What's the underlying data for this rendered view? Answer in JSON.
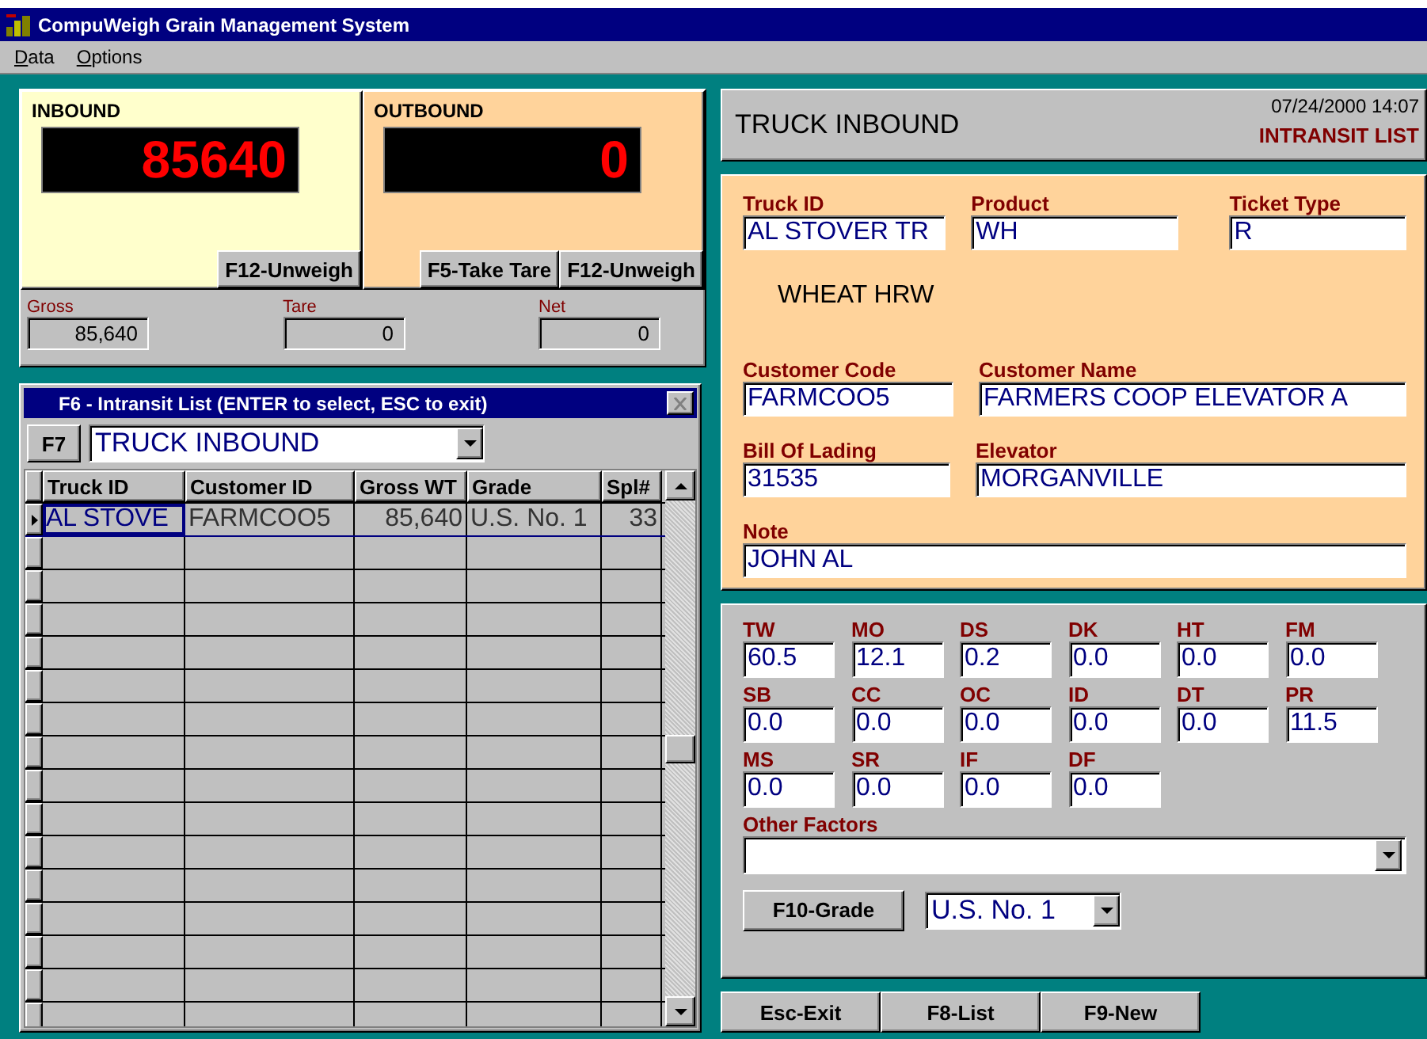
{
  "window": {
    "title": "CompuWeigh Grain Management System"
  },
  "menu": [
    "Data",
    "Options"
  ],
  "scales": [
    {
      "label": "INBOUND",
      "reading": "85640",
      "color": "#ffffcc",
      "buttons": [
        "F12-Unweigh"
      ]
    },
    {
      "label": "OUTBOUND",
      "reading": "0",
      "color": "#ffd39b",
      "buttons": [
        "F5-Take Tare",
        "F12-Unweigh"
      ]
    }
  ],
  "totals": [
    {
      "label": "Gross",
      "value": "85,640"
    },
    {
      "label": "Tare",
      "value": "0"
    },
    {
      "label": "Net",
      "value": "0"
    }
  ],
  "intransit": {
    "title": "F6 - Intransit List (ENTER to select, ESC to exit)",
    "filter_button": "F7",
    "filter": "TRUCK INBOUND",
    "columns": [
      "Truck ID",
      "Customer ID",
      "Gross WT",
      "Grade",
      "Spl#"
    ],
    "rows": [
      {
        "selected": true,
        "cells": [
          "AL STOVE",
          "FARMCOO5",
          "85,640",
          "U.S. No. 1",
          "33"
        ]
      }
    ]
  },
  "header": {
    "title": "TRUCK INBOUND",
    "datetime": "07/24/2000 14:07",
    "mode": "INTRANSIT LIST"
  },
  "ticket": {
    "truck_id": {
      "label": "Truck ID",
      "value": "AL STOVER TR"
    },
    "product": {
      "label": "Product",
      "value": "WH"
    },
    "ticket_type": {
      "label": "Ticket Type",
      "value": "R"
    },
    "product_name": "WHEAT HRW",
    "customer_code": {
      "label": "Customer Code",
      "value": "FARMCOO5"
    },
    "customer_name": {
      "label": "Customer Name",
      "value": "FARMERS COOP ELEVATOR A"
    },
    "bill_of_lading": {
      "label": "Bill Of Lading",
      "value": "31535"
    },
    "elevator": {
      "label": "Elevator",
      "value": "MORGANVILLE"
    },
    "note": {
      "label": "Note",
      "value": "JOHN AL"
    }
  },
  "factors": [
    {
      "label": "TW",
      "value": "60.5"
    },
    {
      "label": "MO",
      "value": "12.1"
    },
    {
      "label": "DS",
      "value": "0.2"
    },
    {
      "label": "DK",
      "value": "0.0"
    },
    {
      "label": "HT",
      "value": "0.0"
    },
    {
      "label": "FM",
      "value": "0.0"
    },
    {
      "label": "SB",
      "value": "0.0"
    },
    {
      "label": "CC",
      "value": "0.0"
    },
    {
      "label": "OC",
      "value": "0.0"
    },
    {
      "label": "ID",
      "value": "0.0"
    },
    {
      "label": "DT",
      "value": "0.0"
    },
    {
      "label": "PR",
      "value": "11.5"
    },
    {
      "label": "MS",
      "value": "0.0"
    },
    {
      "label": "SR",
      "value": "0.0"
    },
    {
      "label": "IF",
      "value": "0.0"
    },
    {
      "label": "DF",
      "value": "0.0"
    }
  ],
  "other_factors": {
    "label": "Other Factors"
  },
  "grade": {
    "button": "F10-Grade",
    "value": "U.S. No. 1"
  },
  "actions": [
    "Esc-Exit",
    "F8-List",
    "F9-New"
  ]
}
